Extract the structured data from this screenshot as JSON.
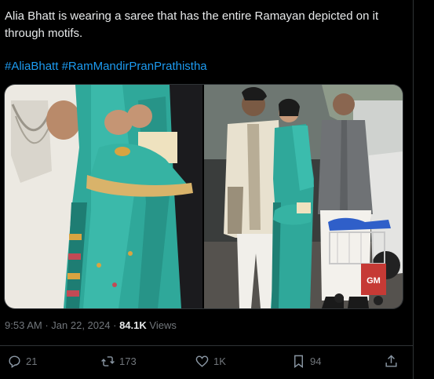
{
  "tweet": {
    "text": "Alia Bhatt is wearing a saree that has the entire Ramayan depicted on it through motifs.",
    "hashtags": [
      "#AliaBhatt",
      "#RamMandirPranPrathistha"
    ]
  },
  "meta": {
    "time": "9:53 AM",
    "separator": "·",
    "date": "Jan 22, 2024",
    "views_count": "84.1K",
    "views_label": "Views"
  },
  "actions": {
    "reply_count": "21",
    "retweet_count": "173",
    "like_count": "1K",
    "bookmark_count": "94"
  },
  "media": {
    "cart_sign": "GM"
  },
  "icons": [
    "reply-icon",
    "retweet-icon",
    "like-icon",
    "bookmark-icon",
    "share-icon"
  ],
  "colors": {
    "background": "#000000",
    "text": "#e7e9ea",
    "secondary": "#71767b",
    "link": "#1d9bf0",
    "border": "#2f3336",
    "saree": "#2fa89a"
  }
}
